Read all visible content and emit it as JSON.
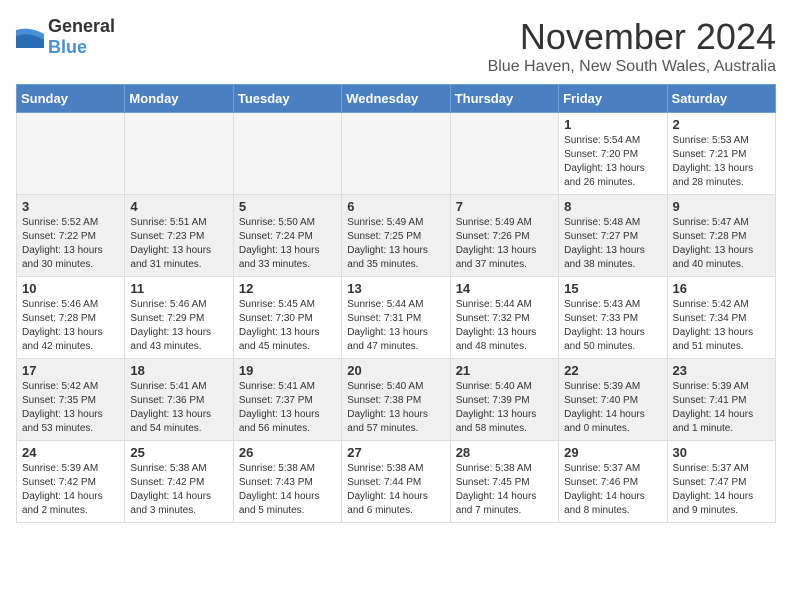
{
  "logo": {
    "text_general": "General",
    "text_blue": "Blue"
  },
  "title": "November 2024",
  "location": "Blue Haven, New South Wales, Australia",
  "days_of_week": [
    "Sunday",
    "Monday",
    "Tuesday",
    "Wednesday",
    "Thursday",
    "Friday",
    "Saturday"
  ],
  "weeks": [
    [
      {
        "day": "",
        "info": ""
      },
      {
        "day": "",
        "info": ""
      },
      {
        "day": "",
        "info": ""
      },
      {
        "day": "",
        "info": ""
      },
      {
        "day": "",
        "info": ""
      },
      {
        "day": "1",
        "info": "Sunrise: 5:54 AM\nSunset: 7:20 PM\nDaylight: 13 hours and 26 minutes."
      },
      {
        "day": "2",
        "info": "Sunrise: 5:53 AM\nSunset: 7:21 PM\nDaylight: 13 hours and 28 minutes."
      }
    ],
    [
      {
        "day": "3",
        "info": "Sunrise: 5:52 AM\nSunset: 7:22 PM\nDaylight: 13 hours and 30 minutes."
      },
      {
        "day": "4",
        "info": "Sunrise: 5:51 AM\nSunset: 7:23 PM\nDaylight: 13 hours and 31 minutes."
      },
      {
        "day": "5",
        "info": "Sunrise: 5:50 AM\nSunset: 7:24 PM\nDaylight: 13 hours and 33 minutes."
      },
      {
        "day": "6",
        "info": "Sunrise: 5:49 AM\nSunset: 7:25 PM\nDaylight: 13 hours and 35 minutes."
      },
      {
        "day": "7",
        "info": "Sunrise: 5:49 AM\nSunset: 7:26 PM\nDaylight: 13 hours and 37 minutes."
      },
      {
        "day": "8",
        "info": "Sunrise: 5:48 AM\nSunset: 7:27 PM\nDaylight: 13 hours and 38 minutes."
      },
      {
        "day": "9",
        "info": "Sunrise: 5:47 AM\nSunset: 7:28 PM\nDaylight: 13 hours and 40 minutes."
      }
    ],
    [
      {
        "day": "10",
        "info": "Sunrise: 5:46 AM\nSunset: 7:28 PM\nDaylight: 13 hours and 42 minutes."
      },
      {
        "day": "11",
        "info": "Sunrise: 5:46 AM\nSunset: 7:29 PM\nDaylight: 13 hours and 43 minutes."
      },
      {
        "day": "12",
        "info": "Sunrise: 5:45 AM\nSunset: 7:30 PM\nDaylight: 13 hours and 45 minutes."
      },
      {
        "day": "13",
        "info": "Sunrise: 5:44 AM\nSunset: 7:31 PM\nDaylight: 13 hours and 47 minutes."
      },
      {
        "day": "14",
        "info": "Sunrise: 5:44 AM\nSunset: 7:32 PM\nDaylight: 13 hours and 48 minutes."
      },
      {
        "day": "15",
        "info": "Sunrise: 5:43 AM\nSunset: 7:33 PM\nDaylight: 13 hours and 50 minutes."
      },
      {
        "day": "16",
        "info": "Sunrise: 5:42 AM\nSunset: 7:34 PM\nDaylight: 13 hours and 51 minutes."
      }
    ],
    [
      {
        "day": "17",
        "info": "Sunrise: 5:42 AM\nSunset: 7:35 PM\nDaylight: 13 hours and 53 minutes."
      },
      {
        "day": "18",
        "info": "Sunrise: 5:41 AM\nSunset: 7:36 PM\nDaylight: 13 hours and 54 minutes."
      },
      {
        "day": "19",
        "info": "Sunrise: 5:41 AM\nSunset: 7:37 PM\nDaylight: 13 hours and 56 minutes."
      },
      {
        "day": "20",
        "info": "Sunrise: 5:40 AM\nSunset: 7:38 PM\nDaylight: 13 hours and 57 minutes."
      },
      {
        "day": "21",
        "info": "Sunrise: 5:40 AM\nSunset: 7:39 PM\nDaylight: 13 hours and 58 minutes."
      },
      {
        "day": "22",
        "info": "Sunrise: 5:39 AM\nSunset: 7:40 PM\nDaylight: 14 hours and 0 minutes."
      },
      {
        "day": "23",
        "info": "Sunrise: 5:39 AM\nSunset: 7:41 PM\nDaylight: 14 hours and 1 minute."
      }
    ],
    [
      {
        "day": "24",
        "info": "Sunrise: 5:39 AM\nSunset: 7:42 PM\nDaylight: 14 hours and 2 minutes."
      },
      {
        "day": "25",
        "info": "Sunrise: 5:38 AM\nSunset: 7:42 PM\nDaylight: 14 hours and 3 minutes."
      },
      {
        "day": "26",
        "info": "Sunrise: 5:38 AM\nSunset: 7:43 PM\nDaylight: 14 hours and 5 minutes."
      },
      {
        "day": "27",
        "info": "Sunrise: 5:38 AM\nSunset: 7:44 PM\nDaylight: 14 hours and 6 minutes."
      },
      {
        "day": "28",
        "info": "Sunrise: 5:38 AM\nSunset: 7:45 PM\nDaylight: 14 hours and 7 minutes."
      },
      {
        "day": "29",
        "info": "Sunrise: 5:37 AM\nSunset: 7:46 PM\nDaylight: 14 hours and 8 minutes."
      },
      {
        "day": "30",
        "info": "Sunrise: 5:37 AM\nSunset: 7:47 PM\nDaylight: 14 hours and 9 minutes."
      }
    ]
  ]
}
